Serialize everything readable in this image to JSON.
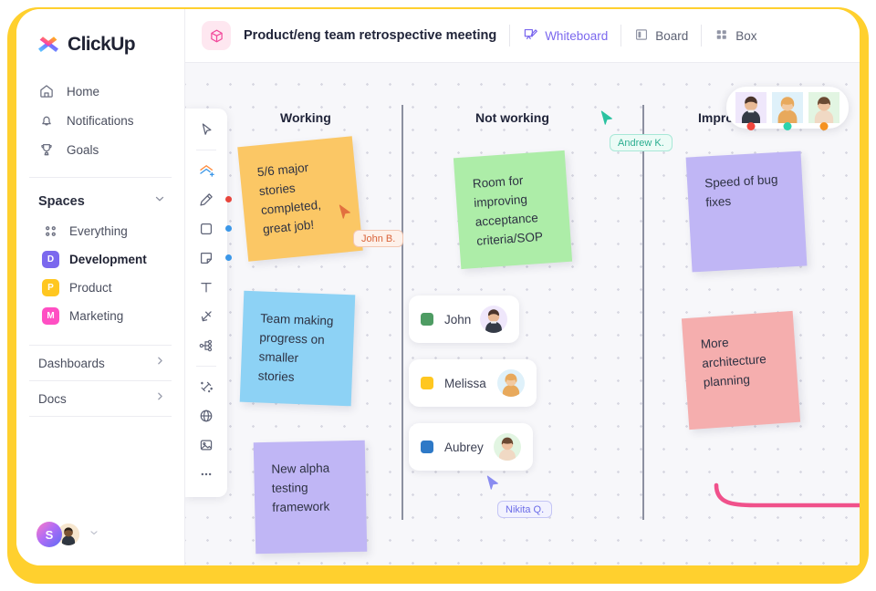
{
  "brand": {
    "name": "ClickUp",
    "logo_icon": "clickup-logo-icon",
    "accent": "#7B68EE",
    "frame_color": "#FFD02E"
  },
  "sidebar": {
    "nav": [
      {
        "label": "Home",
        "icon": "home-icon"
      },
      {
        "label": "Notifications",
        "icon": "bell-icon"
      },
      {
        "label": "Goals",
        "icon": "trophy-icon"
      }
    ],
    "spaces_header": {
      "label": "Spaces",
      "icon": "chevron-down-icon"
    },
    "spaces": [
      {
        "label": "Everything",
        "badge": "",
        "icon": "grid-dots-icon",
        "color": "",
        "active": false
      },
      {
        "label": "Development",
        "badge": "D",
        "color": "#7B68EE",
        "active": true
      },
      {
        "label": "Product",
        "badge": "P",
        "color": "#FFC720",
        "active": false
      },
      {
        "label": "Marketing",
        "badge": "M",
        "color": "#FF4FC3",
        "active": false
      }
    ],
    "footer_items": [
      {
        "label": "Dashboards",
        "icon": "chevron-right-icon"
      },
      {
        "label": "Docs",
        "icon": "chevron-right-icon"
      }
    ],
    "user": {
      "workspace_initial": "S",
      "avatar_icon": "user-avatar",
      "chevron": "chevron-down-icon"
    }
  },
  "topbar": {
    "doc_icon": "box-outline-icon",
    "title": "Product/eng team retrospective meeting",
    "tabs": [
      {
        "label": "Whiteboard",
        "icon": "whiteboard-icon",
        "active": true
      },
      {
        "label": "Board",
        "icon": "board-icon",
        "active": false
      },
      {
        "label": "Box",
        "icon": "box-grid-icon",
        "active": false
      }
    ]
  },
  "toolbar": {
    "tools": [
      {
        "name": "select-pointer-tool",
        "icon": "cursor-arrow-icon",
        "dot": ""
      },
      {
        "name": "shapes-add-tool",
        "icon": "shapes-plus-icon",
        "dot": ""
      },
      {
        "name": "pen-tool",
        "icon": "pen-icon",
        "dot": "#E8453C"
      },
      {
        "name": "rectangle-tool",
        "icon": "square-icon",
        "dot": "#3B97E8"
      },
      {
        "name": "sticky-note-tool",
        "icon": "sticky-note-icon",
        "dot": "#3B97E8"
      },
      {
        "name": "text-tool",
        "icon": "text-t-icon",
        "dot": ""
      },
      {
        "name": "connector-tool",
        "icon": "arrows-diagonal-icon",
        "dot": ""
      },
      {
        "name": "mindmap-tool",
        "icon": "node-tree-icon",
        "dot": ""
      },
      {
        "name": "magic-tool",
        "icon": "magic-wand-icon",
        "dot": ""
      },
      {
        "name": "embed-tool",
        "icon": "globe-icon",
        "dot": ""
      },
      {
        "name": "image-tool",
        "icon": "image-icon",
        "dot": ""
      },
      {
        "name": "more-tool",
        "icon": "ellipsis-icon",
        "dot": ""
      }
    ]
  },
  "board": {
    "columns": [
      {
        "label": "Working"
      },
      {
        "label": "Not working"
      },
      {
        "label": "Improvements"
      }
    ],
    "notes": [
      {
        "id": "note-5-6-major-stories",
        "text": "5/6 major stories completed, great job!",
        "color": "#FBC765"
      },
      {
        "id": "note-team-making-progress",
        "text": "Team making progress on smaller stories",
        "color": "#8DD2F5"
      },
      {
        "id": "note-new-alpha-testing",
        "text": "New alpha testing framework",
        "color": "#C0B6F5"
      },
      {
        "id": "note-room-for-improving",
        "text": "Room for improving acceptance criteria/SOP",
        "color": "#ADEDA8"
      },
      {
        "id": "note-speed-of-bug-fixes",
        "text": "Speed of bug fixes",
        "color": "#C0B6F5"
      },
      {
        "id": "note-more-architecture",
        "text": "More architecture planning",
        "color": "#F5AEAE"
      }
    ],
    "members": [
      {
        "name": "John",
        "chip_color": "#4E9C63"
      },
      {
        "name": "Melissa",
        "chip_color": "#FFC720"
      },
      {
        "name": "Aubrey",
        "chip_color": "#2E79C7"
      }
    ],
    "cursors": [
      {
        "label": "John B.",
        "color": "#D9643A",
        "bg": "#FDEEE6"
      },
      {
        "label": "Andrew K.",
        "color": "#2BC2A0",
        "bg": "#E6FAF4"
      },
      {
        "label": "Nikita Q.",
        "color": "#6B6CE8",
        "bg": "#EEEEFD"
      }
    ]
  },
  "presence": {
    "avatars": [
      {
        "name": "avatar-1",
        "status_color": "#F0453C"
      },
      {
        "name": "avatar-2",
        "status_color": "#2BD3AE"
      },
      {
        "name": "avatar-3",
        "status_color": "#F59120"
      }
    ]
  }
}
